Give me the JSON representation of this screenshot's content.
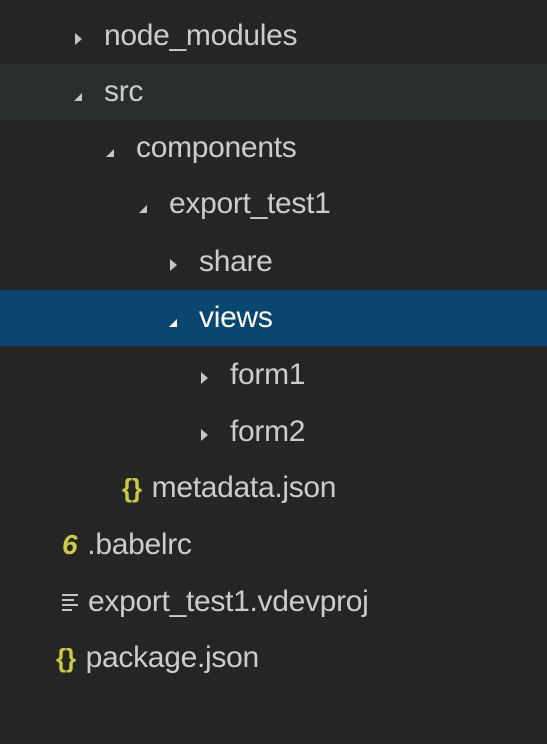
{
  "explorer": {
    "items": [
      {
        "label": "node_modules",
        "type": "folder",
        "expanded": false
      },
      {
        "label": "src",
        "type": "folder",
        "expanded": true
      },
      {
        "label": "components",
        "type": "folder",
        "expanded": true
      },
      {
        "label": "export_test1",
        "type": "folder",
        "expanded": true
      },
      {
        "label": "share",
        "type": "folder",
        "expanded": false
      },
      {
        "label": "views",
        "type": "folder",
        "expanded": true,
        "selected": true
      },
      {
        "label": "form1",
        "type": "folder",
        "expanded": false
      },
      {
        "label": "form2",
        "type": "folder",
        "expanded": false
      },
      {
        "label": "metadata.json",
        "type": "file",
        "icon": "json-braces-icon"
      },
      {
        "label": ".babelrc",
        "type": "file",
        "icon": "babel-icon"
      },
      {
        "label": "export_test1.vdevproj",
        "type": "file",
        "icon": "text-lines-icon"
      },
      {
        "label": "package.json",
        "type": "file",
        "icon": "json-braces-icon"
      }
    ],
    "icons": {
      "json": "{}",
      "babel": "6"
    },
    "colors": {
      "background": "#252526",
      "selected": "#094771",
      "hover": "#2a2d2e",
      "json_icon": "#cbcb41",
      "text": "#cccccc"
    }
  }
}
